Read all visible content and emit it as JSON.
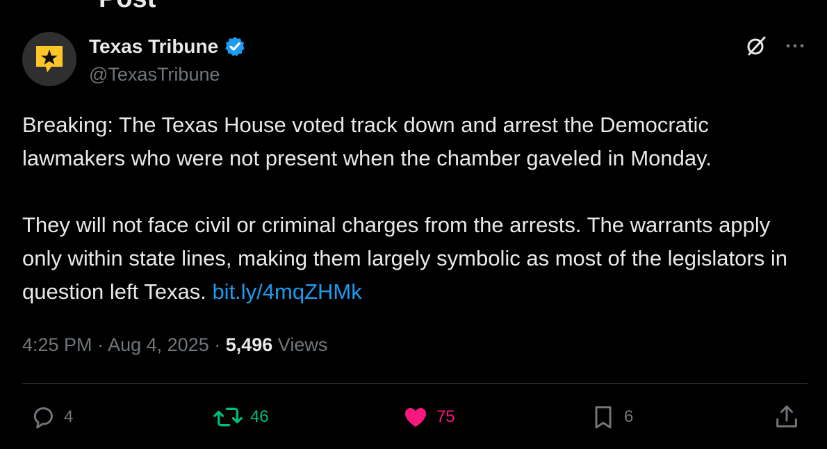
{
  "header": {
    "title": "Post"
  },
  "author": {
    "display_name": "Texas Tribune",
    "handle": "@TexasTribune",
    "verified": true,
    "avatar_colors": {
      "bg": "#2f2f2f",
      "badge": "#ffc629",
      "star": "#111111"
    }
  },
  "post": {
    "paragraph1": "Breaking: The Texas House voted track down and arrest the Democratic lawmakers who were not present when the chamber gaveled in Monday.",
    "paragraph2_text": "They will not face civil or criminal charges from the arrests. The warrants apply only within state lines, making them largely symbolic as most of the legislators in question left Texas. ",
    "link": "bit.ly/4mqZHMk"
  },
  "meta": {
    "time": "4:25 PM",
    "separator1": " · ",
    "date": "Aug 4, 2025",
    "separator2": " · ",
    "views_count": "5,496",
    "views_label": " Views"
  },
  "actions": {
    "reply_count": "4",
    "retweet_count": "46",
    "like_count": "75",
    "bookmark_count": "6"
  },
  "colors": {
    "link": "#1d9bf0",
    "retweet": "#00ba7c",
    "like": "#f91880",
    "verified": "#1d9bf0",
    "muted": "#71767b"
  }
}
